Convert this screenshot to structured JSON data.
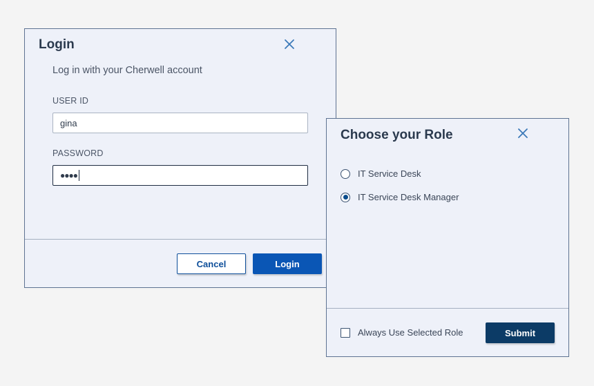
{
  "login_dialog": {
    "title": "Login",
    "close_icon": "close-icon",
    "subtitle": "Log in with your Cherwell account",
    "user_id_label": "USER ID",
    "user_id_value": "gina",
    "password_label": "PASSWORD",
    "password_value": "●●●●",
    "cancel_label": "Cancel",
    "login_label": "Login"
  },
  "role_dialog": {
    "title": "Choose your Role",
    "close_icon": "close-icon",
    "options": [
      {
        "label": "IT Service Desk",
        "selected": false
      },
      {
        "label": "IT Service Desk Manager",
        "selected": true
      }
    ],
    "always_use_label": "Always Use Selected Role",
    "always_use_checked": false,
    "submit_label": "Submit"
  },
  "colors": {
    "accent_primary": "#0a56b5",
    "accent_dark": "#0c3b66",
    "dialog_background": "#eef1f9",
    "close_icon": "#3b79b8"
  }
}
